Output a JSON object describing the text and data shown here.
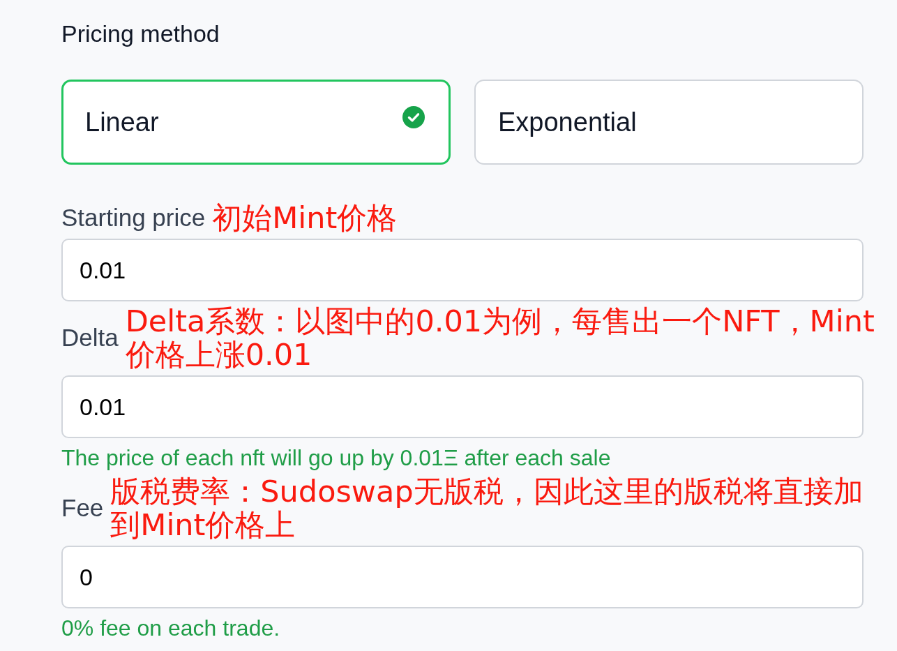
{
  "pricing_method": {
    "label": "Pricing method",
    "options": [
      {
        "label": "Linear",
        "selected": true
      },
      {
        "label": "Exponential",
        "selected": false
      }
    ]
  },
  "fields": [
    {
      "label": "Starting price",
      "annotation": {
        "lines": [
          "初始Mint价格"
        ]
      },
      "value": "0.01"
    },
    {
      "label": "Delta",
      "annotation": {
        "lines": [
          "Delta系数：以图中的0.01为例，每售出一个NFT，Mint",
          "价格上涨0.01"
        ]
      },
      "value": "0.01",
      "helper": "The price of each nft will go up by 0.01Ξ after each sale"
    },
    {
      "label": "Fee",
      "annotation": {
        "lines": [
          "版税费率：Sudoswap无版税，因此这里的版税将直接加",
          "到Mint价格上"
        ]
      },
      "value": "0",
      "helper": "0% fee on each trade."
    }
  ]
}
